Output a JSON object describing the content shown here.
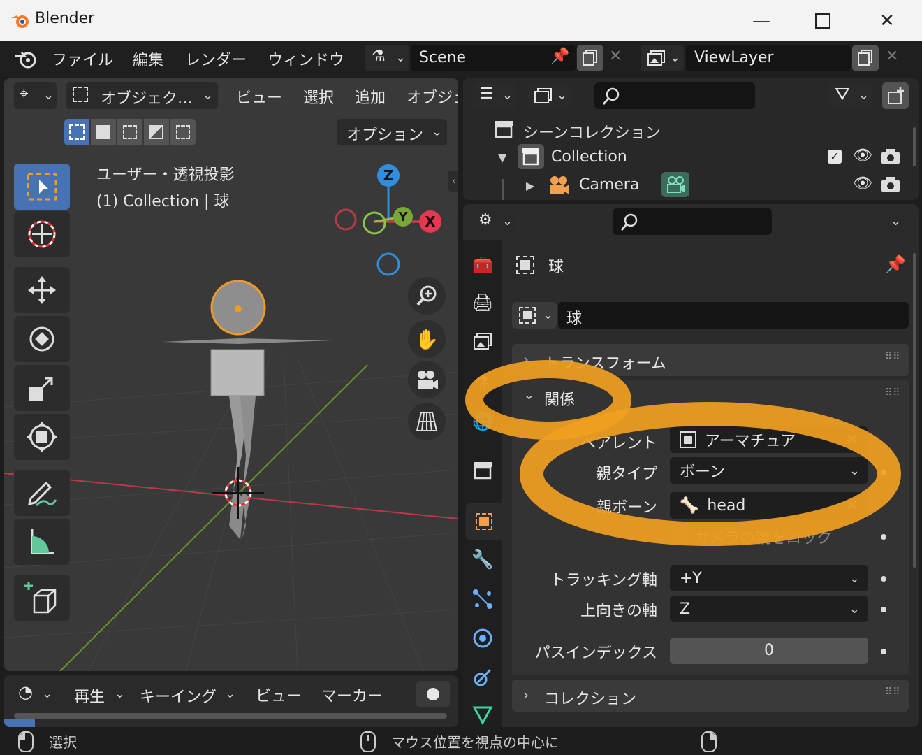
{
  "window": {
    "title": "Blender"
  },
  "menu": [
    "ファイル",
    "編集",
    "レンダー",
    "ウィンドウ"
  ],
  "scene": {
    "name": "Scene"
  },
  "view_layer": {
    "name": "ViewLayer"
  },
  "viewport": {
    "mode": "オブジェク…",
    "menus": [
      "ビュー",
      "選択",
      "追加",
      "オブジェ"
    ],
    "options_label": "オプション",
    "view_title": "ユーザー・透視投影",
    "view_subtitle": "(1) Collection | 球",
    "axes": {
      "z": "Z",
      "y": "Y",
      "x": "X"
    }
  },
  "outliner": {
    "scene_collection": "シーンコレクション",
    "items": [
      {
        "label": "Collection"
      },
      {
        "label": "Camera"
      }
    ]
  },
  "properties": {
    "object_name": "球",
    "object_field": "球",
    "panels": {
      "transform": "トランスフォーム",
      "relations": "関係",
      "collection": "コレクション"
    },
    "relations": {
      "parent_label": "ペアレント",
      "parent_value": "アーマチュア",
      "parent_type_label": "親タイプ",
      "parent_type_value": "ボーン",
      "parent_bone_label": "親ボーン",
      "parent_bone_value": "head",
      "lock_camera_label": "カメラの親をロック",
      "tracking_axis_label": "トラッキング軸",
      "tracking_axis_value": "+Y",
      "up_axis_label": "上向きの軸",
      "up_axis_value": "Z",
      "pass_index_label": "パスインデックス",
      "pass_index_value": "0"
    }
  },
  "timeline": {
    "menus": [
      "再生",
      "キーイング",
      "ビュー",
      "マーカー"
    ]
  },
  "status": {
    "left": "選択",
    "middle": "マウス位置を視点の中心に"
  },
  "colors": {
    "accent_blue": "#4772b3",
    "highlight_orange": "#f0a020",
    "axis_x": "#e8384f",
    "axis_y": "#8bc34a",
    "axis_z": "#2f8ee0"
  }
}
